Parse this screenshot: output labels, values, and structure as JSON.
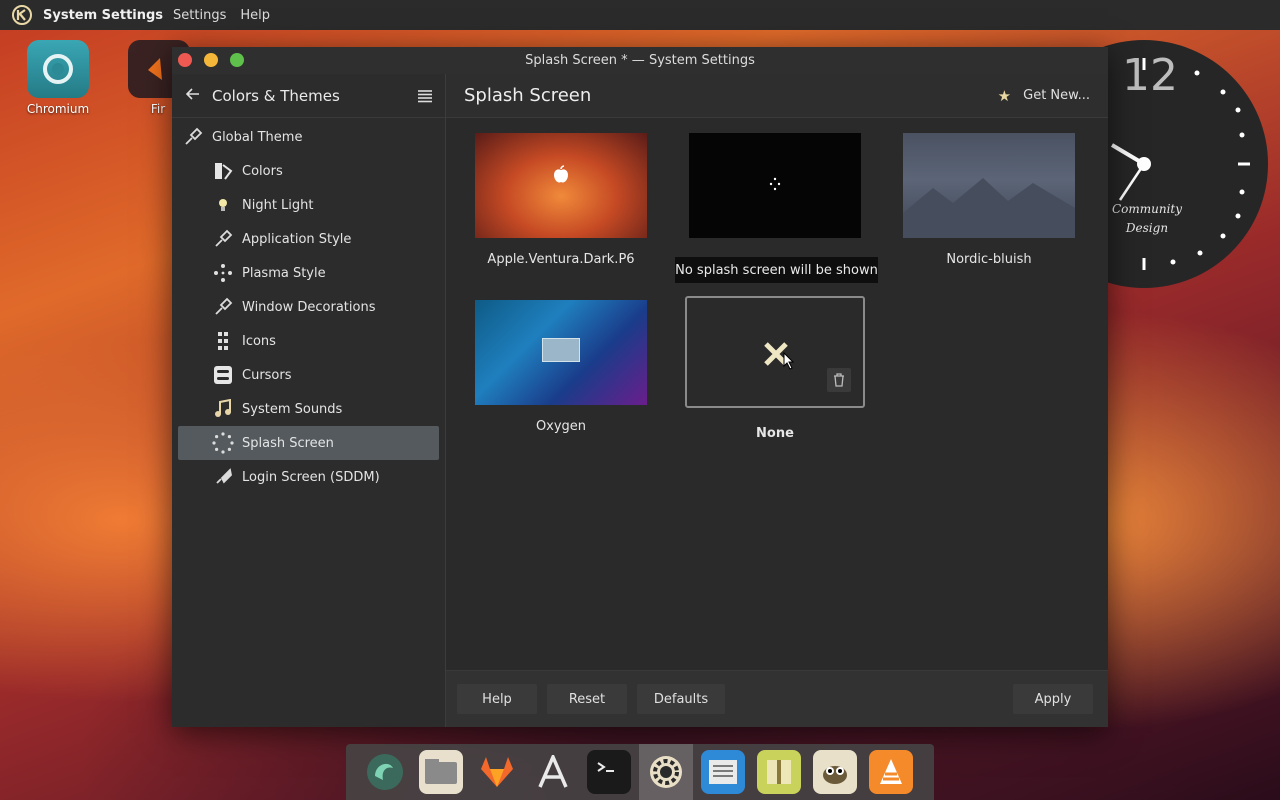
{
  "topbar": {
    "app_name": "System Settings",
    "menus": [
      "Settings",
      "Help"
    ]
  },
  "desktop": {
    "icons": [
      {
        "label": "Chromium",
        "icon": "chromium-icon"
      },
      {
        "label": "Fir",
        "icon": "firefox-icon"
      }
    ],
    "clock": {
      "hour_label": "12",
      "brand_line1": "Community",
      "brand_line2": "Design"
    }
  },
  "window": {
    "title": "Splash Screen * — System Settings",
    "sidebar": {
      "back_title": "Colors & Themes",
      "items": [
        {
          "label": "Global Theme",
          "icon": "brush-icon",
          "level": "top"
        },
        {
          "label": "Colors",
          "icon": "palette-icon",
          "level": "sub"
        },
        {
          "label": "Night Light",
          "icon": "bulb-icon",
          "level": "sub"
        },
        {
          "label": "Application Style",
          "icon": "brush-icon",
          "level": "sub"
        },
        {
          "label": "Plasma Style",
          "icon": "plasma-icon",
          "level": "sub"
        },
        {
          "label": "Window Decorations",
          "icon": "brush-icon",
          "level": "sub"
        },
        {
          "label": "Icons",
          "icon": "icons-icon",
          "level": "sub"
        },
        {
          "label": "Cursors",
          "icon": "cursor-icon",
          "level": "sub"
        },
        {
          "label": "System Sounds",
          "icon": "music-note-icon",
          "level": "sub"
        },
        {
          "label": "Splash Screen",
          "icon": "spinner-icon",
          "level": "sub",
          "active": true
        },
        {
          "label": "Login Screen (SDDM)",
          "icon": "rocket-icon",
          "level": "sub"
        }
      ]
    },
    "content": {
      "title": "Splash Screen",
      "get_new_label": "Get New...",
      "themes": [
        {
          "name": "Apple.Ventura.Dark.P6"
        },
        {
          "name": ""
        },
        {
          "name": "Nordic-bluish"
        },
        {
          "name": "Oxygen"
        },
        {
          "name": "None",
          "selected": true
        }
      ],
      "tooltip": "No splash screen will be shown",
      "footer": {
        "help_label": "Help",
        "reset_label": "Reset",
        "defaults_label": "Defaults",
        "apply_label": "Apply"
      }
    }
  },
  "dock": {
    "items": [
      "app-launcher-icon",
      "file-manager-icon",
      "gitlab-icon",
      "text-editor-icon",
      "terminal-icon",
      "system-settings-icon",
      "news-reader-icon",
      "archive-icon",
      "gimp-icon",
      "vlc-icon"
    ],
    "active": "system-settings-icon"
  }
}
